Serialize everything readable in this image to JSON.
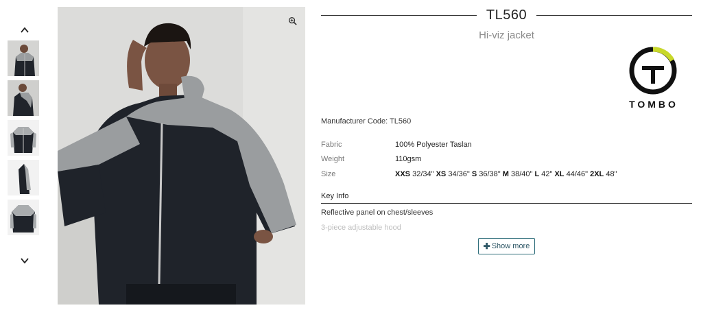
{
  "thumbnails": {
    "up_icon": "chevron-up-icon",
    "down_icon": "chevron-down-icon",
    "items": [
      {
        "alt": "Model front view"
      },
      {
        "alt": "Model side view"
      },
      {
        "alt": "Jacket flat front"
      },
      {
        "alt": "Jacket flat side"
      },
      {
        "alt": "Jacket flat back"
      }
    ]
  },
  "main_image": {
    "zoom_icon": "zoom-in-icon"
  },
  "product": {
    "code": "TL560",
    "name": "Hi-viz jacket",
    "brand_wordmark": "TOMBO",
    "manufacturer_code_label": "Manufacturer Code:",
    "manufacturer_code": "TL560",
    "specs": {
      "fabric_label": "Fabric",
      "fabric_value": "100% Polyester Taslan",
      "weight_label": "Weight",
      "weight_value": "110gsm",
      "size_label": "Size",
      "sizes": [
        {
          "size": "XXS",
          "measure": "32/34\""
        },
        {
          "size": "XS",
          "measure": "34/36\""
        },
        {
          "size": "S",
          "measure": "36/38\""
        },
        {
          "size": "M",
          "measure": "38/40\""
        },
        {
          "size": "L",
          "measure": "42\""
        },
        {
          "size": "XL",
          "measure": "44/46\""
        },
        {
          "size": "2XL",
          "measure": "48\""
        }
      ]
    },
    "key_info": {
      "heading": "Key Info",
      "items": [
        "Reflective panel on chest/sleeves",
        "3-piece adjustable hood"
      ]
    },
    "show_more_label": "Show more",
    "show_more_icon": "plus-icon"
  },
  "colors": {
    "accent": "#2e6d7a",
    "logo_yellow": "#c8d82a",
    "jacket_dark": "#1f232a",
    "jacket_reflective": "#9a9d9f"
  }
}
